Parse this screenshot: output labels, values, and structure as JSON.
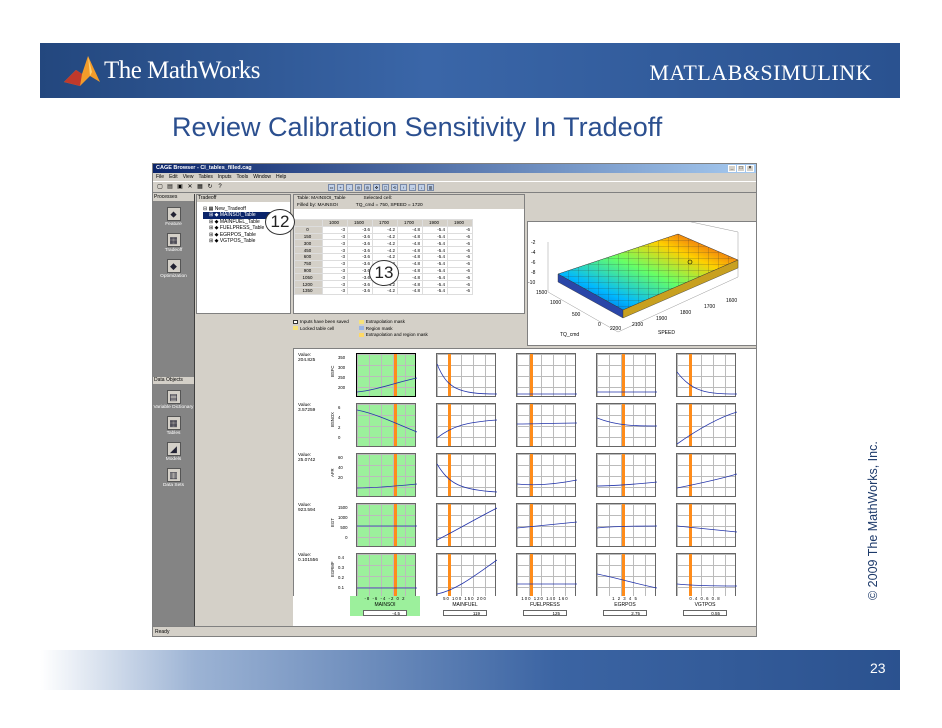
{
  "header": {
    "company": "The MathWorks",
    "products": "MATLAB&SIMULINK"
  },
  "slide": {
    "title": "Review Calibration Sensitivity In Tradeoff",
    "copyright": "© 2009 The MathWorks, Inc.",
    "page": "23"
  },
  "window": {
    "title": "CAGE Browser - CI_tables_filled.cag",
    "menu": [
      "File",
      "Edit",
      "View",
      "Tables",
      "Inputs",
      "Tools",
      "Window",
      "Help"
    ],
    "status": "Ready"
  },
  "left_panel": {
    "processes_label": "Processes",
    "processes": [
      "Feature",
      "Tradeoff",
      "Optimization"
    ],
    "data_objects_label": "Data Objects",
    "data_objects": [
      "Variable Dictionary",
      "Tables",
      "Models",
      "Data Sets"
    ]
  },
  "tree": {
    "header": "Tradeoff",
    "root": "New_Tradeoff",
    "items": [
      "MAINSOI_Table",
      "MAINFUEL_Table",
      "FUELPRESS_Table",
      "EGRPOS_Table",
      "VGTPOS_Table"
    ]
  },
  "table": {
    "info1": "Table: MAINSOI_Table",
    "info2": "Selected cell:",
    "info3": "Filled by: MAINSOI",
    "info4": "TQ_cmd = 750, SPEED = 1720",
    "cols": [
      "1000",
      "1500",
      "1700",
      "1700",
      "1900",
      "1900"
    ],
    "rows": [
      [
        "0",
        "-3",
        "-3.6",
        "-4.2",
        "-4.8",
        "-5.4",
        "-6"
      ],
      [
        "150",
        "-3",
        "-3.6",
        "-4.2",
        "-4.8",
        "-5.4",
        "-6"
      ],
      [
        "300",
        "-3",
        "-3.6",
        "-4.2",
        "-4.8",
        "-5.4",
        "-6"
      ],
      [
        "450",
        "-3",
        "-3.6",
        "-4.2",
        "-4.8",
        "-5.4",
        "-6"
      ],
      [
        "600",
        "-3",
        "-3.6",
        "-4.2",
        "-4.8",
        "-5.4",
        "-6"
      ],
      [
        "750",
        "-3",
        "-3.6",
        "-4.2",
        "-4.8",
        "-5.4",
        "-6"
      ],
      [
        "900",
        "-3",
        "-3.6",
        "-4.2",
        "-4.8",
        "-5.4",
        "-6"
      ],
      [
        "1050",
        "-3",
        "-3.6",
        "-4.2",
        "-4.8",
        "-5.4",
        "-6"
      ],
      [
        "1200",
        "-3",
        "-3.6",
        "-4.2",
        "-4.8",
        "-5.4",
        "-6"
      ],
      [
        "1350",
        "-3",
        "-3.6",
        "-4.2",
        "-4.8",
        "-5.4",
        "-6"
      ]
    ],
    "legend": [
      "Inputs have been saved",
      "Locked table cell",
      "Extrapolation mask",
      "Region mask",
      "Extrapolation and region mask"
    ]
  },
  "surface": {
    "xlabel": "TQ_cmd",
    "ylabel": "SPEED",
    "zticks": [
      "-2",
      "-4",
      "-6",
      "-8",
      "-10"
    ],
    "yticks": [
      "2000",
      "1500",
      "1000",
      "500",
      "0"
    ],
    "xticks": [
      "2100",
      "2200",
      "1900",
      "1800",
      "1700",
      "1600"
    ]
  },
  "callouts": [
    "12",
    "13"
  ],
  "plots": {
    "rows": [
      {
        "label": "Value:",
        "value": "204.825",
        "ylab": "BSFC",
        "ticks": [
          "350",
          "300",
          "250",
          "200"
        ]
      },
      {
        "label": "Value:",
        "value": "3.57259",
        "ylab": "BSNOX",
        "ticks": [
          "6",
          "4",
          "2",
          "0"
        ]
      },
      {
        "label": "Value:",
        "value": "25.0742",
        "ylab": "AFR",
        "ticks": [
          "60",
          "40",
          "20"
        ]
      },
      {
        "label": "Value:",
        "value": "923.594",
        "ylab": "EGT",
        "ticks": [
          "1500",
          "1000",
          "500",
          "0"
        ]
      },
      {
        "label": "Value:",
        "value": "0.101556",
        "ylab": "EGRMF",
        "ticks": [
          "0.4",
          "0.3",
          "0.2",
          "0.1",
          "0"
        ]
      }
    ],
    "x_axes": [
      {
        "ticks": "-8 -6 -4 -2 0 2",
        "name": "MAINSOI",
        "value": "-4.5"
      },
      {
        "ticks": "50 100 150 200",
        "name": "MAINFUEL",
        "value": "119"
      },
      {
        "ticks": "100 120 140 160",
        "name": "FUELPRESS",
        "value": "125"
      },
      {
        "ticks": "1 2 3 4 5",
        "name": "EGRPOS",
        "value": "2.75"
      },
      {
        "ticks": "0.4 0.6 0.8",
        "name": "VGTPOS",
        "value": "0.55"
      }
    ]
  }
}
